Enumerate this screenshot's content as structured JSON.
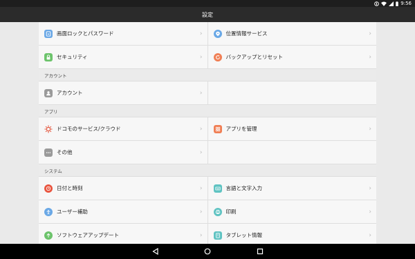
{
  "status": {
    "time": "9:56"
  },
  "title": "設定",
  "rows_top": [
    [
      {
        "label": "画面ロックとパスワード",
        "icon": "lock-screen-icon",
        "color": "#6aa8e6"
      },
      {
        "label": "位置情報サービス",
        "icon": "location-icon",
        "color": "#6aa8e6"
      }
    ],
    [
      {
        "label": "セキュリティ",
        "icon": "padlock-icon",
        "color": "#6cc36b"
      },
      {
        "label": "バックアップとリセット",
        "icon": "backup-icon",
        "color": "#f07f55"
      }
    ]
  ],
  "sections": {
    "account": "アカウント",
    "apps": "アプリ",
    "system": "システム"
  },
  "account_row": {
    "label": "アカウント",
    "icon": "person-icon",
    "color": "#9a9a9a"
  },
  "apps_rows": [
    [
      {
        "label": "ドコモのサービス/クラウド",
        "icon": "docomo-icon",
        "color": "#e4553c"
      },
      {
        "label": "アプリを管理",
        "icon": "apps-grid-icon",
        "color": "#f07f55"
      }
    ],
    [
      {
        "label": "その他",
        "icon": "more-icon",
        "color": "#9a9a9a"
      },
      null
    ]
  ],
  "system_rows": [
    [
      {
        "label": "日付と時刻",
        "icon": "clock-icon",
        "color": "#e9553f"
      },
      {
        "label": "言語と文字入力",
        "icon": "keyboard-icon",
        "color": "#5fc3c2"
      }
    ],
    [
      {
        "label": "ユーザー補助",
        "icon": "accessibility-icon",
        "color": "#6aa8e6"
      },
      {
        "label": "印刷",
        "icon": "printer-icon",
        "color": "#5fc3c2"
      }
    ],
    [
      {
        "label": "ソフトウェアアップデート",
        "icon": "update-icon",
        "color": "#6cc36b"
      },
      {
        "label": "タブレット情報",
        "icon": "tablet-info-icon",
        "color": "#5fc3c2"
      }
    ]
  ]
}
